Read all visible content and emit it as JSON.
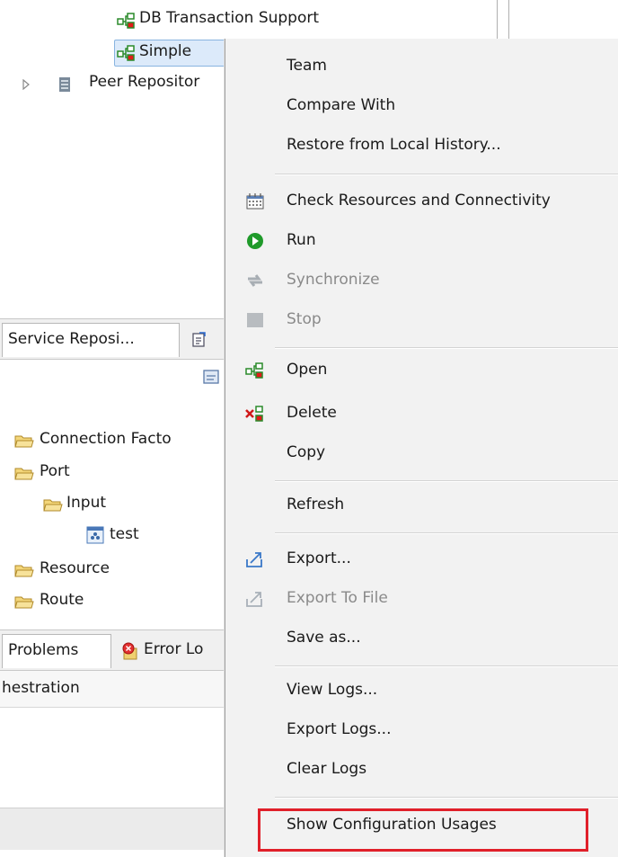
{
  "top_tree": {
    "items": [
      {
        "label": "DB Transaction Support"
      },
      {
        "label": "Simple"
      },
      {
        "label": "Peer Repositor"
      }
    ]
  },
  "views": {
    "tab1": "Service Reposi...",
    "tree": [
      {
        "label": "Connection Facto"
      },
      {
        "label": "Port"
      },
      {
        "label": "Input"
      },
      {
        "label": "test"
      },
      {
        "label": "Resource"
      },
      {
        "label": "Route"
      }
    ],
    "tab_problems": "Problems",
    "tab_errorlog": "Error Lo",
    "column_header": "hestration"
  },
  "context_menu": {
    "team": "Team",
    "compare_with": "Compare With",
    "restore": "Restore from Local History...",
    "check": "Check Resources and Connectivity",
    "run": "Run",
    "synchronize": "Synchronize",
    "stop": "Stop",
    "open": "Open",
    "delete": "Delete",
    "copy": "Copy",
    "refresh": "Refresh",
    "export": "Export...",
    "export_to_file": "Export To File",
    "save_as": "Save as...",
    "view_logs": "View Logs...",
    "export_logs": "Export Logs...",
    "clear_logs": "Clear Logs",
    "show_config_usages": "Show Configuration Usages"
  },
  "colors": {
    "highlight_box": "#e0202a",
    "run_icon": "#1f9a2a",
    "selection": "#dceafa"
  }
}
